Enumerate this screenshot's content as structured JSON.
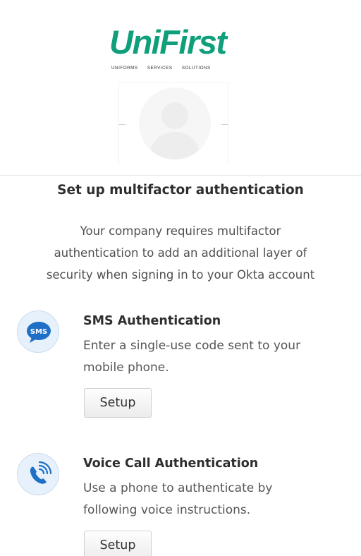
{
  "logo": {
    "brand": "UniFirst",
    "tagline": [
      "UNIFORMS",
      "SERVICES",
      "SOLUTIONS"
    ]
  },
  "page": {
    "title": "Set up multifactor authentication",
    "subtitle_lines": [
      "Your company requires multifactor",
      "authentication to add an additional layer of",
      "security when signing in to your Okta account"
    ]
  },
  "factors": [
    {
      "icon": "sms-icon",
      "icon_text": "SMS",
      "name": "SMS Authentication",
      "description_lines": [
        "Enter a single-use code sent to your",
        "mobile phone."
      ],
      "button": "Setup"
    },
    {
      "icon": "voice-call-icon",
      "name": "Voice Call Authentication",
      "description_lines": [
        "Use a phone to authenticate by",
        "following voice instructions."
      ],
      "button": "Setup"
    }
  ],
  "colors": {
    "brand_green": "#0f9f7a",
    "icon_blue": "#1f6fc6",
    "icon_bg": "#e7f1fb"
  }
}
